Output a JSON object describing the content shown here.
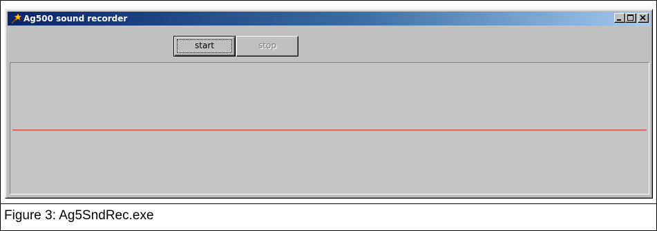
{
  "window": {
    "title": "Ag500 sound recorder",
    "icon": "wand-icon"
  },
  "titlebar_controls": [
    "minimize",
    "maximize",
    "close"
  ],
  "toolbar": {
    "start_label": "start",
    "stop_label": "stop",
    "stop_enabled": false
  },
  "waveform": {
    "line_color": "#d03030",
    "background": "#c4c4c4"
  },
  "caption": "Figure 3:  Ag5SndRec.exe"
}
